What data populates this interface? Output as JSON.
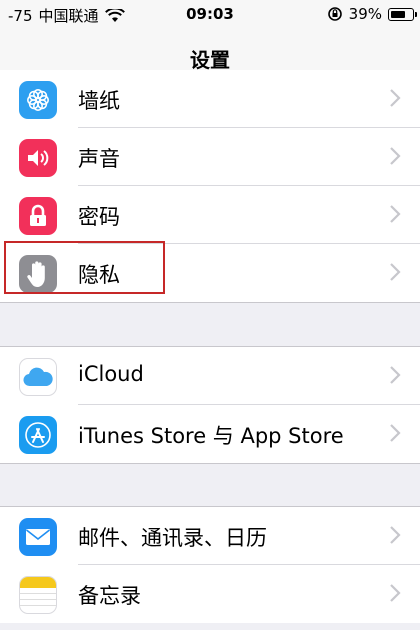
{
  "status_bar": {
    "signal": "-75",
    "carrier": "中国联通",
    "time": "09:03",
    "battery_text": "39%"
  },
  "nav": {
    "title": "设置"
  },
  "group1": [
    {
      "label": "墙纸",
      "icon": "wallpaper-flower-icon",
      "color": "#2d9ff0"
    },
    {
      "label": "声音",
      "icon": "speaker-icon",
      "color": "#f2305a"
    },
    {
      "label": "密码",
      "icon": "lock-icon",
      "color": "#f2305a"
    },
    {
      "label": "隐私",
      "icon": "hand-icon",
      "color": "#8e8e93"
    }
  ],
  "group2": [
    {
      "label": "iCloud",
      "icon": "cloud-icon"
    },
    {
      "label": "iTunes Store 与 App Store",
      "icon": "app-store-icon",
      "color": "#1a9cf0"
    }
  ],
  "group3": [
    {
      "label": "邮件、通讯录、日历",
      "icon": "mail-icon",
      "color": "#1f8ef2"
    },
    {
      "label": "备忘录",
      "icon": "notes-icon",
      "color": "#f5c81c"
    }
  ],
  "highlight_color": "#c62828"
}
